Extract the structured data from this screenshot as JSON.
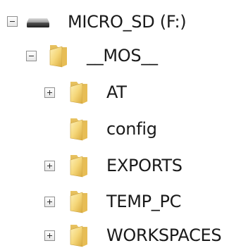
{
  "tree": {
    "root": {
      "label": "MICRO_SD (F:)",
      "icon": "drive-icon",
      "expanded": true
    },
    "mos": {
      "label": "__MOS__",
      "icon": "folder-icon",
      "expanded": true
    },
    "children": [
      {
        "label": "AT",
        "icon": "folder-icon",
        "has_children": true
      },
      {
        "label": "config",
        "icon": "folder-icon",
        "has_children": false
      },
      {
        "label": "EXPORTS",
        "icon": "folder-icon",
        "has_children": true
      },
      {
        "label": "TEMP_PC",
        "icon": "folder-icon",
        "has_children": true
      },
      {
        "label": "WORKSPACES",
        "icon": "folder-icon",
        "has_children": true
      }
    ]
  },
  "colors": {
    "folder_light": "#f8e39a",
    "folder_dark": "#d9b24a",
    "drive_body": "#3a3a3a",
    "text": "#1a1a1a"
  }
}
